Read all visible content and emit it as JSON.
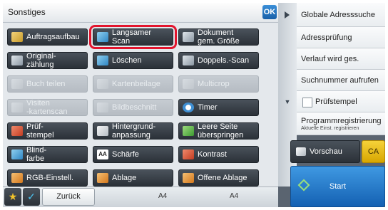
{
  "header": {
    "title": "Sonstiges",
    "ok_label": "OK"
  },
  "functions": [
    {
      "label": "Auftragsaufbau",
      "icon": "job-build-icon",
      "color": "c-yellow"
    },
    {
      "label": "Langsamer Scan",
      "icon": "slow-scan-icon",
      "color": "c-blue",
      "highlighted": true
    },
    {
      "label": "Dokument\ngem. Größe",
      "icon": "mixed-size-original-icon",
      "color": "c-gray"
    },
    {
      "label": "Original-\nzählung",
      "icon": "original-count-icon",
      "color": "c-gray"
    },
    {
      "label": "Löschen",
      "icon": "erase-icon",
      "color": "c-blue"
    },
    {
      "label": "Doppels.-Scan",
      "icon": "duplex-scan-icon",
      "color": "c-gray"
    },
    {
      "label": "Buch teilen",
      "icon": "book-divide-icon",
      "disabled": true
    },
    {
      "label": "Kartenbeilage",
      "icon": "card-insert-icon",
      "disabled": true
    },
    {
      "label": "Multicrop",
      "icon": "multicrop-icon",
      "disabled": true
    },
    {
      "label": "Visiten\n-kartenscan",
      "icon": "business-card-scan-icon",
      "disabled": true
    },
    {
      "label": "Bildbeschnitt",
      "icon": "image-crop-icon",
      "disabled": true
    },
    {
      "label": "Timer",
      "icon": "timer-icon",
      "color": "clock"
    },
    {
      "label": "Prüf-\nstempel",
      "icon": "verification-stamp-icon",
      "color": "c-red"
    },
    {
      "label": "Hintergrund-\nanpassung",
      "icon": "background-adjust-icon",
      "color": "c-light"
    },
    {
      "label": "Leere Seite\nüberspringen",
      "icon": "skip-blank-page-icon",
      "color": "c-green"
    },
    {
      "label": "Blind-\nfarbe",
      "icon": "drop-out-color-icon",
      "color": "c-blue"
    },
    {
      "label": "Schärfe",
      "icon": "sharpness-icon",
      "color": "aa",
      "glyph": "AA"
    },
    {
      "label": "Kontrast",
      "icon": "contrast-icon",
      "color": "c-red"
    },
    {
      "label": "RGB-Einstell.",
      "icon": "rgb-adjust-icon",
      "color": "c-orange"
    },
    {
      "label": "Ablage",
      "icon": "filing-icon",
      "color": "c-orange"
    },
    {
      "label": "Offene Ablage",
      "icon": "quick-file-icon",
      "color": "c-orange"
    }
  ],
  "right_menu": {
    "items": [
      "Globale Adresssuche",
      "Adressprüfung",
      "Verlauf wird ges.",
      "Suchnummer aufrufen",
      "Prüfstempel",
      "Programmregistrierung"
    ],
    "program_sub": "Aktuelle Einst. registrieren"
  },
  "preview_label": "Vorschau",
  "ca_label": "CA",
  "start_label": "Start",
  "bottom": {
    "back_label": "Zurück",
    "paper_left": "A4",
    "paper_right": "A4"
  },
  "colors": {
    "highlight": "#e2142d",
    "start": "#1e6fc4",
    "ca": "#f0c419",
    "ok": "#1f6fc0"
  }
}
